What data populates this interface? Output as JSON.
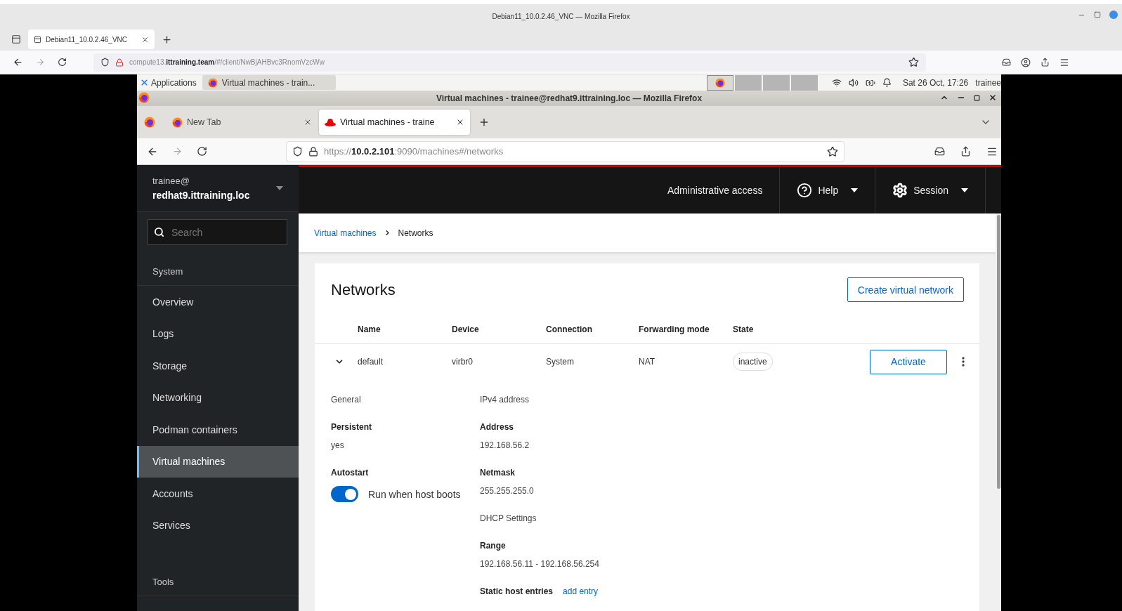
{
  "outer_window": {
    "title": "Debian11_10.0.2.46_VNC — Mozilla Firefox",
    "tab": "Debian11_10.0.2.46_VNC",
    "url": "compute13.**ittraining.team**/#/client/NwBjAHBvc3RnomVzcWw"
  },
  "desktop_taskbar": {
    "applications": "Applications",
    "task": "Virtual machines - train...",
    "clock": "Sat 26 Oct, 17:26",
    "user": "trainee"
  },
  "inner_window": {
    "title": "Virtual machines - trainee@redhat9.ittraining.loc — Mozilla Firefox",
    "tabs": [
      {
        "label": "New Tab",
        "selected": false
      },
      {
        "label": "Virtual machines - traine",
        "selected": true
      }
    ],
    "url": "https://**10.0.2.101**:9090/machines#/networks"
  },
  "cockpit": {
    "host": {
      "user": "trainee@",
      "hostname": "redhat9.ittraining.loc"
    },
    "search": {
      "placeholder": "Search"
    },
    "sidebar": {
      "items": [
        {
          "label": "System",
          "kind": "section"
        },
        {
          "label": "Overview",
          "kind": "item",
          "selected": false
        },
        {
          "label": "Logs",
          "kind": "item",
          "selected": false
        },
        {
          "label": "Storage",
          "kind": "item",
          "selected": false
        },
        {
          "label": "Networking",
          "kind": "item",
          "selected": false
        },
        {
          "label": "Podman containers",
          "kind": "item",
          "selected": false
        },
        {
          "label": "Virtual machines",
          "kind": "item",
          "selected": true
        },
        {
          "label": "Accounts",
          "kind": "item",
          "selected": false
        },
        {
          "label": "Services",
          "kind": "item",
          "selected": false
        },
        {
          "label": "Tools",
          "kind": "section"
        }
      ]
    },
    "header": {
      "admin": "Administrative access",
      "help": "Help",
      "session": "Session"
    },
    "breadcrumb": [
      {
        "label": "Virtual machines",
        "kind": "link"
      },
      {
        "label": "Networks",
        "kind": "current"
      }
    ],
    "card": {
      "title": "Networks",
      "create_button": "Create virtual network",
      "columns": [
        "Name",
        "Device",
        "Connection",
        "Forwarding mode",
        "State"
      ],
      "rows": [
        {
          "expanded": true,
          "cells": [
            "default",
            "virbr0",
            "System",
            "NAT"
          ],
          "state": "inactive",
          "action": "Activate",
          "details": {
            "general": {
              "heading": "General",
              "fields": [
                {
                  "kind": "text",
                  "label": "Persistent",
                  "value": "yes"
                },
                {
                  "kind": "toggle",
                  "label": "Autostart",
                  "on": true,
                  "text": "Run when host boots"
                }
              ]
            },
            "ipv4": {
              "heading": "IPv4 address",
              "fields": [
                {
                  "kind": "text",
                  "label": "Address",
                  "value": "192.168.56.2"
                },
                {
                  "kind": "text",
                  "label": "Netmask",
                  "value": "255.255.255.0"
                }
              ]
            },
            "dhcp": {
              "heading": "DHCP Settings",
              "fields": [
                {
                  "kind": "text",
                  "label": "Range",
                  "value": "192.168.56.11 - 192.168.56.254"
                }
              ]
            },
            "static_hosts": {
              "label": "Static host entries",
              "link": "add entry"
            }
          }
        }
      ]
    }
  }
}
